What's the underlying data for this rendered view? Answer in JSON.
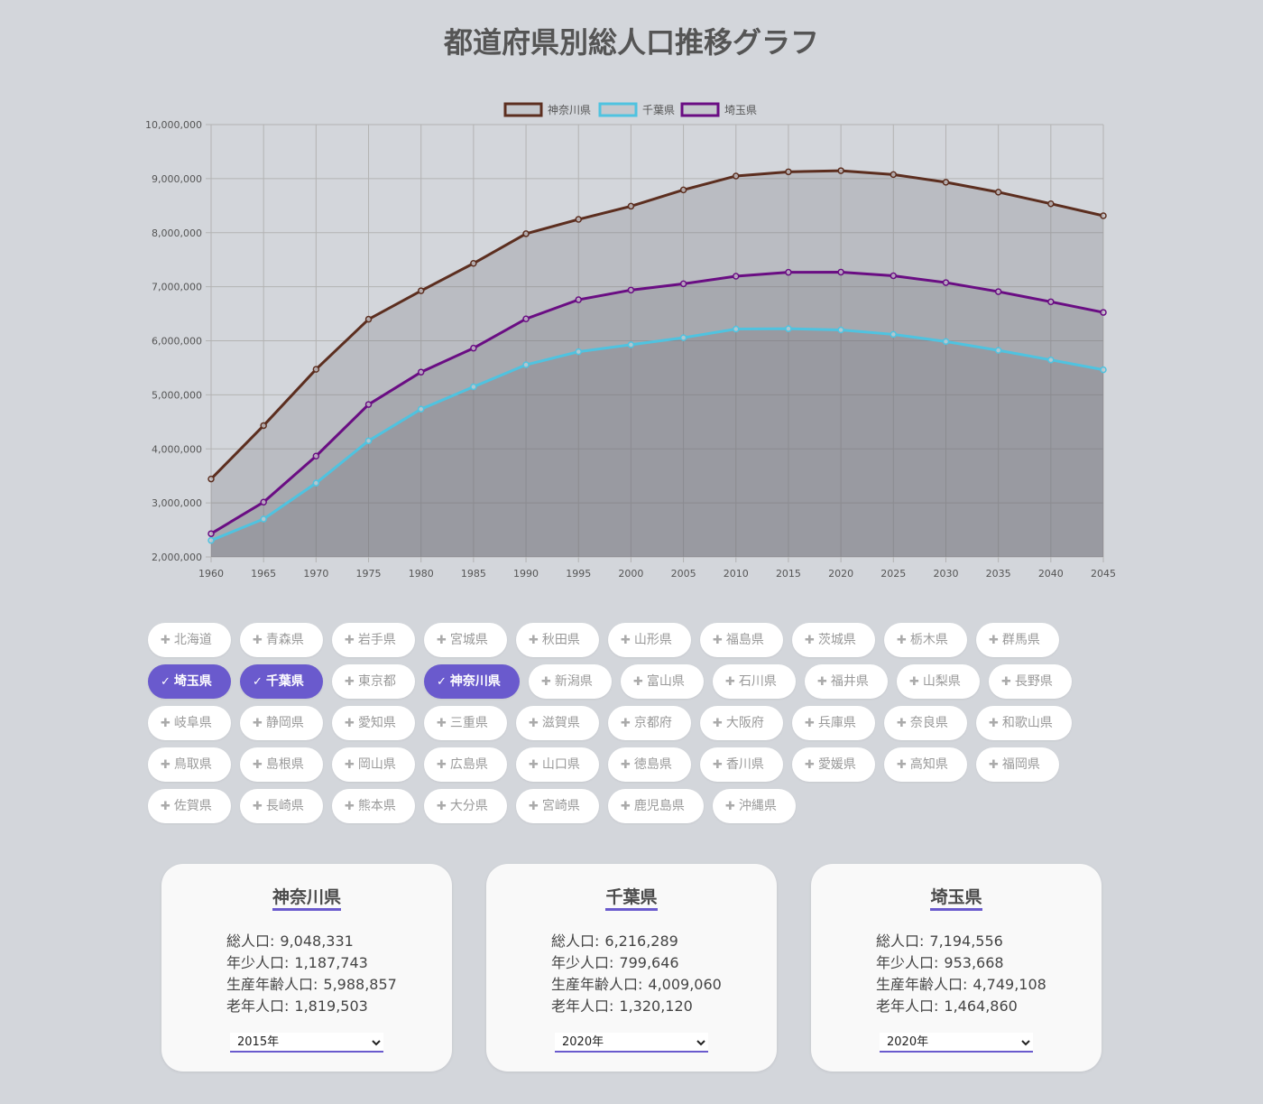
{
  "page": {
    "title": "都道府県別総人口推移グラフ"
  },
  "chart_data": {
    "type": "area",
    "x": [
      1960,
      1965,
      1970,
      1975,
      1980,
      1985,
      1990,
      1995,
      2000,
      2005,
      2010,
      2015,
      2020,
      2025,
      2030,
      2035,
      2040,
      2045
    ],
    "ylim": [
      2000000,
      10000000
    ],
    "yticks": [
      "2,000,000",
      "3,000,000",
      "4,000,000",
      "5,000,000",
      "6,000,000",
      "7,000,000",
      "8,000,000",
      "9,000,000",
      "10,000,000"
    ],
    "grid": true,
    "legend": "top",
    "series": [
      {
        "name": "神奈川県",
        "color": "#5c2e1f",
        "values": [
          3443176,
          4430743,
          5472247,
          6397748,
          6924348,
          7431974,
          7980391,
          8245900,
          8489974,
          8791597,
          9048331,
          9126214,
          9147000,
          9075000,
          8933000,
          8750000,
          8535000,
          8313000
        ]
      },
      {
        "name": "千葉県",
        "color": "#4fc3e0",
        "values": [
          2306010,
          2701770,
          3366624,
          4149147,
          4735424,
          5148163,
          5555429,
          5797782,
          5926285,
          6056462,
          6216289,
          6222666,
          6200000,
          6118000,
          5986000,
          5823000,
          5646000,
          5463000
        ]
      },
      {
        "name": "埼玉県",
        "color": "#6a0d83",
        "values": [
          2430871,
          3014983,
          3866472,
          4821340,
          5420480,
          5863678,
          6405319,
          6759311,
          6938006,
          7054243,
          7194556,
          7266534,
          7270000,
          7203000,
          7076000,
          6909000,
          6721000,
          6525000
        ]
      }
    ]
  },
  "prefectures": [
    {
      "label": "北海道",
      "selected": false
    },
    {
      "label": "青森県",
      "selected": false
    },
    {
      "label": "岩手県",
      "selected": false
    },
    {
      "label": "宮城県",
      "selected": false
    },
    {
      "label": "秋田県",
      "selected": false
    },
    {
      "label": "山形県",
      "selected": false
    },
    {
      "label": "福島県",
      "selected": false
    },
    {
      "label": "茨城県",
      "selected": false
    },
    {
      "label": "栃木県",
      "selected": false
    },
    {
      "label": "群馬県",
      "selected": false
    },
    {
      "label": "埼玉県",
      "selected": true
    },
    {
      "label": "千葉県",
      "selected": true
    },
    {
      "label": "東京都",
      "selected": false
    },
    {
      "label": "神奈川県",
      "selected": true
    },
    {
      "label": "新潟県",
      "selected": false
    },
    {
      "label": "富山県",
      "selected": false
    },
    {
      "label": "石川県",
      "selected": false
    },
    {
      "label": "福井県",
      "selected": false
    },
    {
      "label": "山梨県",
      "selected": false
    },
    {
      "label": "長野県",
      "selected": false
    },
    {
      "label": "岐阜県",
      "selected": false
    },
    {
      "label": "静岡県",
      "selected": false
    },
    {
      "label": "愛知県",
      "selected": false
    },
    {
      "label": "三重県",
      "selected": false
    },
    {
      "label": "滋賀県",
      "selected": false
    },
    {
      "label": "京都府",
      "selected": false
    },
    {
      "label": "大阪府",
      "selected": false
    },
    {
      "label": "兵庫県",
      "selected": false
    },
    {
      "label": "奈良県",
      "selected": false
    },
    {
      "label": "和歌山県",
      "selected": false
    },
    {
      "label": "鳥取県",
      "selected": false
    },
    {
      "label": "島根県",
      "selected": false
    },
    {
      "label": "岡山県",
      "selected": false
    },
    {
      "label": "広島県",
      "selected": false
    },
    {
      "label": "山口県",
      "selected": false
    },
    {
      "label": "徳島県",
      "selected": false
    },
    {
      "label": "香川県",
      "selected": false
    },
    {
      "label": "愛媛県",
      "selected": false
    },
    {
      "label": "高知県",
      "selected": false
    },
    {
      "label": "福岡県",
      "selected": false
    },
    {
      "label": "佐賀県",
      "selected": false
    },
    {
      "label": "長崎県",
      "selected": false
    },
    {
      "label": "熊本県",
      "selected": false
    },
    {
      "label": "大分県",
      "selected": false
    },
    {
      "label": "宮崎県",
      "selected": false
    },
    {
      "label": "鹿児島県",
      "selected": false
    },
    {
      "label": "沖縄県",
      "selected": false
    }
  ],
  "icons": {
    "unselected": "plus-icon",
    "selected": "check-icon"
  },
  "accent_color": "#6a5acd",
  "cards": [
    {
      "title": "神奈川県",
      "total_label": "総人口:",
      "total": "9,048,331",
      "young_label": "年少人口:",
      "young": "1,187,743",
      "working_label": "生産年齢人口:",
      "working": "5,988,857",
      "elderly_label": "老年人口:",
      "elderly": "1,819,503",
      "year": "2015年"
    },
    {
      "title": "千葉県",
      "total_label": "総人口:",
      "total": "6,216,289",
      "young_label": "年少人口:",
      "young": "799,646",
      "working_label": "生産年齢人口:",
      "working": "4,009,060",
      "elderly_label": "老年人口:",
      "elderly": "1,320,120",
      "year": "2020年"
    },
    {
      "title": "埼玉県",
      "total_label": "総人口:",
      "total": "7,194,556",
      "young_label": "年少人口:",
      "young": "953,668",
      "working_label": "生産年齢人口:",
      "working": "4,749,108",
      "elderly_label": "老年人口:",
      "elderly": "1,464,860",
      "year": "2020年"
    }
  ]
}
